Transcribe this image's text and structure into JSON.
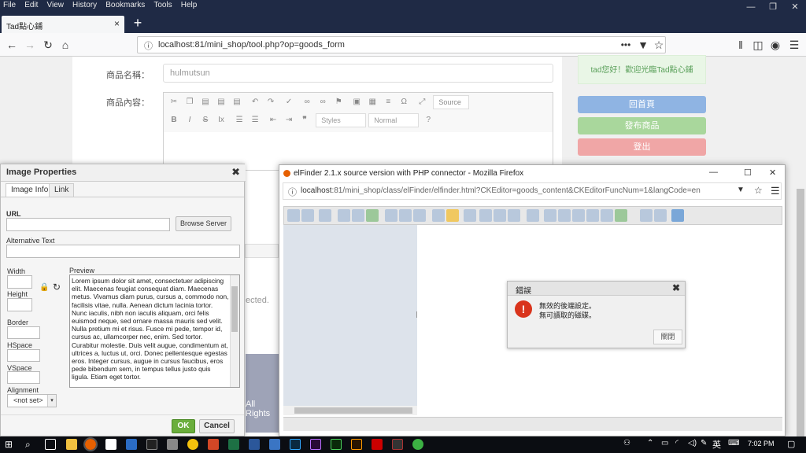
{
  "menubar": {
    "items": [
      "File",
      "Edit",
      "View",
      "History",
      "Bookmarks",
      "Tools",
      "Help"
    ]
  },
  "browser": {
    "tab_title": "Tad點心鋪",
    "url": "localhost:81/mini_shop/tool.php?op=goods_form"
  },
  "form": {
    "name_label": "商品名稱：",
    "name_value": "hulmutsun",
    "content_label": "商品內容："
  },
  "editor": {
    "source_label": "Source",
    "styles_placeholder": "Styles",
    "format_placeholder": "Normal"
  },
  "sidebar": {
    "welcome": "tad您好！歡迎光臨Tad點心鋪",
    "home": "回首頁",
    "post": "發布商品",
    "logout": "登出"
  },
  "background_text": {
    "selected_fragment": "ected.",
    "footer_fragment": "All Rights"
  },
  "image_dialog": {
    "title": "Image Properties",
    "tabs": [
      "Image Info",
      "Link"
    ],
    "url_label": "URL",
    "browse_button": "Browse Server",
    "alt_label": "Alternative Text",
    "width_label": "Width",
    "height_label": "Height",
    "border_label": "Border",
    "hspace_label": "HSpace",
    "vspace_label": "VSpace",
    "alignment_label": "Alignment",
    "alignment_value": "<not set>",
    "preview_label": "Preview",
    "preview_text": "Lorem ipsum dolor sit amet, consectetuer adipiscing elit. Maecenas feugiat consequat diam. Maecenas metus. Vivamus diam purus, cursus a, commodo non, facilisis vitae, nulla. Aenean dictum lacinia tortor. Nunc iaculis, nibh non iaculis aliquam, orci felis euismod neque, sed ornare massa mauris sed velit. Nulla pretium mi et risus. Fusce mi pede, tempor id, cursus ac, ullamcorper nec, enim. Sed tortor. Curabitur molestie. Duis velit augue, condimentum at, ultrices a, luctus ut, orci. Donec pellentesque egestas eros. Integer cursus, augue in cursus faucibus, eros pede bibendum sem, in tempus tellus justo quis ligula. Etiam eget tortor.",
    "ok": "OK",
    "cancel": "Cancel"
  },
  "elfinder": {
    "title": "elFinder 2.1.x source version with PHP connector - Mozilla Firefox",
    "url_host": "localhost",
    "url_rest": ":81/mini_shop/class/elFinder/elfinder.html?CKEditor=goods_content&CKEditorFuncNum=1&langCode=en"
  },
  "error_dialog": {
    "title": "錯誤",
    "line1": "無效的後端設定。",
    "line2": "無可讀取的磁碟。",
    "close": "關閉"
  },
  "taskbar": {
    "ime": "英",
    "time": "7:02 PM"
  },
  "colors": {
    "home": "#8fb4e3",
    "post": "#a9d79c",
    "logout": "#f0a6a6",
    "os_bar": "#1f2a45"
  }
}
